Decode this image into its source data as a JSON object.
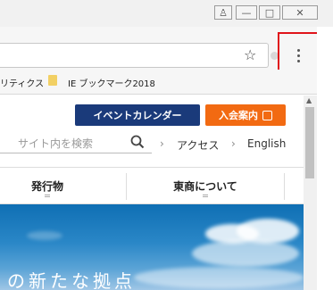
{
  "browser": {
    "window_controls": {
      "user": "♙",
      "minimize": "—",
      "maximize": "□",
      "close": "✕"
    },
    "bookmarks": [
      {
        "label": "リティクス"
      },
      {
        "label": "IE ブックマーク2018"
      }
    ],
    "star_icon": "☆",
    "highlight_color": "#e0141a"
  },
  "page": {
    "event_calendar_button": "イベントカレンダー",
    "membership_button": "入会案内",
    "search_placeholder": "サイト内を検索",
    "nav_links": [
      {
        "label": "アクセス"
      },
      {
        "label": "English"
      }
    ],
    "tabs": [
      {
        "label": "発行物"
      },
      {
        "label": "東商について"
      }
    ],
    "hero_text": "の新たな拠点",
    "colors": {
      "navy": "#1a3a7a",
      "orange": "#f26a12"
    }
  }
}
